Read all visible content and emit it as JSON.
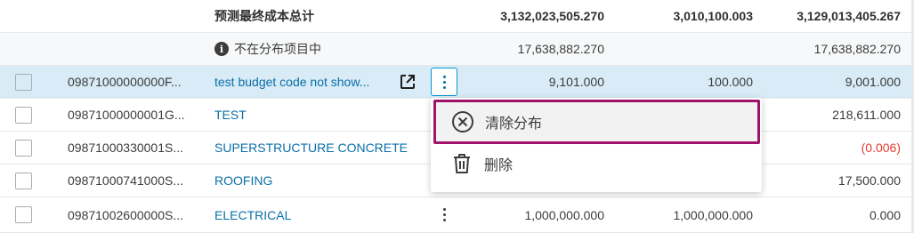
{
  "totals": {
    "label": "预测最终成本总计",
    "v1": "3,132,023,505.270",
    "v2": "3,010,100.003",
    "v3": "3,129,013,405.267"
  },
  "unallocated": {
    "info_icon": "info-icon",
    "label": "不在分布项目中",
    "v1": "17,638,882.270",
    "v3": "17,638,882.270"
  },
  "rows": [
    {
      "code": "09871000000000F...",
      "name": "test budget code not show...",
      "v1": "9,101.000",
      "v2": "100.000",
      "v3": "9,001.000"
    },
    {
      "code": "09871000000001G...",
      "name": "TEST",
      "v1": "",
      "v2": "",
      "v3": "218,611.000"
    },
    {
      "code": "09871000330001S...",
      "name": "SUPERSTRUCTURE CONCRETE",
      "v1": "",
      "v2": "",
      "v3": "(0.006)"
    },
    {
      "code": "09871000741000S...",
      "name": "ROOFING",
      "v1": "",
      "v2": "",
      "v3": "17,500.000"
    },
    {
      "code": "09871002600000S...",
      "name": "ELECTRICAL",
      "v1": "1,000,000.000",
      "v2": "1,000,000.000",
      "v3": "0.000"
    }
  ],
  "menu": {
    "items": [
      {
        "label": "清除分布",
        "icon": "circle-x-icon"
      },
      {
        "label": "删除",
        "icon": "trash-icon"
      }
    ]
  },
  "colors": {
    "link": "#0a6fa8",
    "negative": "#e33b2e",
    "selected_row": "#d8ebf6",
    "highlight_border": "#a0136b"
  }
}
